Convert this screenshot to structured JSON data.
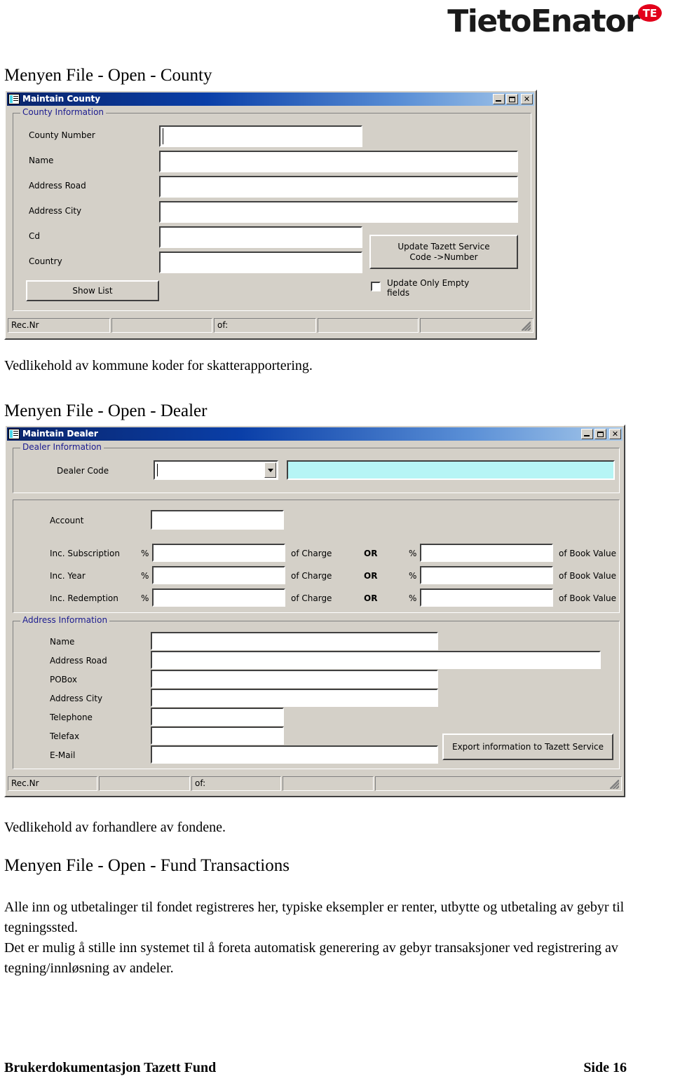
{
  "header": {
    "logo_text": "TietoEnator",
    "logo_badge": "TE",
    "brand_red": "#e2001a"
  },
  "sections": [
    {
      "heading": "Menyen File - Open - County",
      "caption": "Vedlikehold av kommune koder for skatterapportering."
    },
    {
      "heading": "Menyen File - Open - Dealer",
      "caption": "Vedlikehold av forhandlere av fondene."
    },
    {
      "heading": "Menyen File - Open - Fund Transactions",
      "paragraphs": [
        "Alle inn og utbetalinger til fondet registreres her, typiske eksempler er renter, utbytte og utbetaling av gebyr til tegningssted.",
        "Det er mulig å stille inn systemet til å foreta automatisk generering av gebyr transaksjoner ved registrering av tegning/innløsning av andeler."
      ]
    }
  ],
  "county_window": {
    "title": "Maintain County",
    "group_title": "County Information",
    "fields": [
      {
        "label": "County Number",
        "value": ""
      },
      {
        "label": "Name",
        "value": ""
      },
      {
        "label": "Address Road",
        "value": ""
      },
      {
        "label": "Address City",
        "value": ""
      },
      {
        "label": "Cd",
        "value": ""
      },
      {
        "label": "Country",
        "value": ""
      }
    ],
    "show_list_button": "Show List",
    "update_button": "Update Tazett Service\nCode ->Number",
    "checkbox_label": "Update Only Empty\nfields",
    "checkbox_checked": false,
    "status": {
      "rec_nr": "Rec.Nr",
      "rec_value": "",
      "of": "of:",
      "of_value": "",
      "extra": ""
    },
    "buttons": {
      "minimize": "_",
      "maximize": "□",
      "close": "✕"
    }
  },
  "dealer_window": {
    "title": "Maintain Dealer",
    "dealer_group_title": "Dealer Information",
    "dealer_code_label": "Dealer Code",
    "dealer_code_value": "",
    "dealer_name_value": "",
    "account_label": "Account",
    "account_value": "",
    "pct_symbol": "%",
    "or_label": "OR",
    "of_charge_label": "of Charge",
    "of_book_value_label": "of Book Value",
    "inc_rows": [
      {
        "label": "Inc. Subscription",
        "charge_value": "",
        "book_value": ""
      },
      {
        "label": "Inc. Year",
        "charge_value": "",
        "book_value": ""
      },
      {
        "label": "Inc. Redemption",
        "charge_value": "",
        "book_value": ""
      }
    ],
    "address_group_title": "Address Information",
    "address_fields": [
      {
        "label": "Name",
        "value": ""
      },
      {
        "label": "Address Road",
        "value": ""
      },
      {
        "label": "POBox",
        "value": ""
      },
      {
        "label": "Address City",
        "value": ""
      },
      {
        "label": "Telephone",
        "value": ""
      },
      {
        "label": "Telefax",
        "value": ""
      },
      {
        "label": "E-Mail",
        "value": ""
      }
    ],
    "export_button": "Export information to Tazett Service",
    "status": {
      "rec_nr": "Rec.Nr",
      "rec_value": "",
      "of": "of:",
      "of_value": "",
      "extra": ""
    },
    "buttons": {
      "minimize": "_",
      "maximize": "□",
      "close": "✕"
    }
  },
  "footer": {
    "left": "Brukerdokumentasjon Tazett Fund",
    "right": "Side 16"
  }
}
